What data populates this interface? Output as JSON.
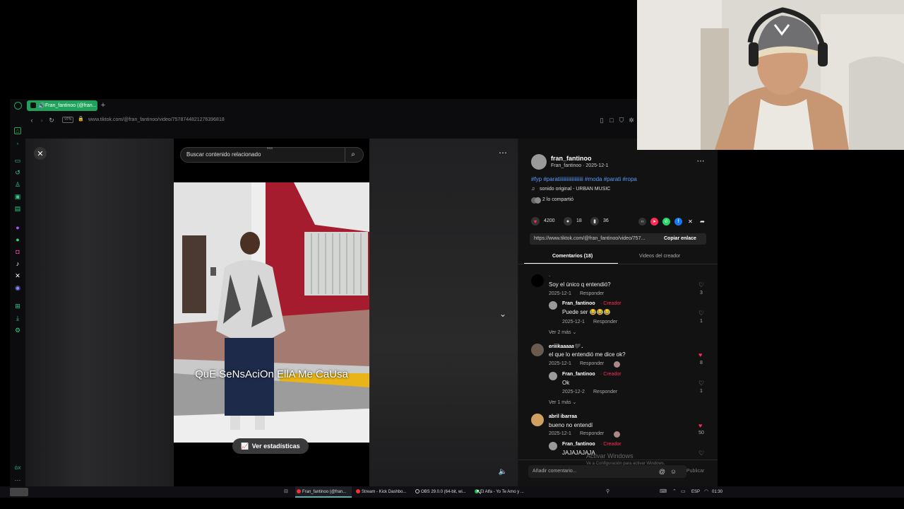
{
  "browser": {
    "tab_title": "Fran_fantinoo (@fran...",
    "address": "www.tiktok.com/@fran_fantinoo/video/7578744821276396818",
    "vpn_label": "VPN",
    "new_tab_icon": "plus-icon"
  },
  "video": {
    "search_placeholder": "Buscar contenido relacionado",
    "search_badge": "RSS",
    "caption": "QuE  SeNsAciOn EllA Me CaUsa",
    "stats_label": "Ver estadísticas"
  },
  "post": {
    "author": "fran_fantinoo",
    "author_line": "Fran_fantinoo · 2025-12-1",
    "hashtags": "#fyp #paratiiiiiiiiiiiiiiiiiii #moda #parati #ropa",
    "sound": "sonido original - URBAN MUSIC",
    "shared": "2 lo compartió",
    "likes": "4200",
    "comments": "18",
    "saves": "36",
    "link": "https://www.tiktok.com/@fran_fantinoo/video/757...",
    "copy_label": "Copiar enlace",
    "tab_comments": "Comentarios (18)",
    "tab_videos": "Videos del creador",
    "comment_input_placeholder": "Añadir comentario...",
    "publish_label": "Publicar"
  },
  "comments": [
    {
      "user": ".",
      "text": "Soy el único q entendió?",
      "date": "2025-12-1",
      "reply": "Responder",
      "likes": "3"
    },
    {
      "user": "Fran_fantinoo",
      "badge": "Creador",
      "text": "Puede ser 😂😂😂",
      "date": "2025-12-1",
      "reply": "Responder",
      "likes": "1",
      "more": "Ver 2 más"
    },
    {
      "user": "eriiikaaaaa🖤 .",
      "text": "el que lo entendió me dice ok?",
      "date": "2025-12-1",
      "reply": "Responder",
      "likes": "8"
    },
    {
      "user": "Fran_fantinoo",
      "badge": "Creador",
      "text": "Ok",
      "date": "2025-12-2",
      "reply": "Responder",
      "likes": "1",
      "more": "Ver 1 más"
    },
    {
      "user": "abril ibarraa",
      "text": "bueno no entendí",
      "date": "2025-12-1",
      "reply": "Responder",
      "likes": "50"
    },
    {
      "user": "Fran_fantinoo",
      "badge": "Creador",
      "text": "JAJAJAJAJA",
      "likes": ""
    }
  ],
  "watermark": {
    "line1": "Activar Windows",
    "line2": "Ve a Configuración para activar Windows."
  },
  "taskbar": {
    "items": [
      "Fran_fantinoo (@fran...",
      "Stream - Kick Dashbo...",
      "OBS 29.0.0 (64-bit, wi...",
      "El Alfa - Yo Te Amo y ..."
    ],
    "lang": "ESP",
    "time": "01:30"
  },
  "colors": {
    "accent": "#fe2c55",
    "tab_green": "#1fa35a",
    "link_blue": "#5b9bff"
  }
}
